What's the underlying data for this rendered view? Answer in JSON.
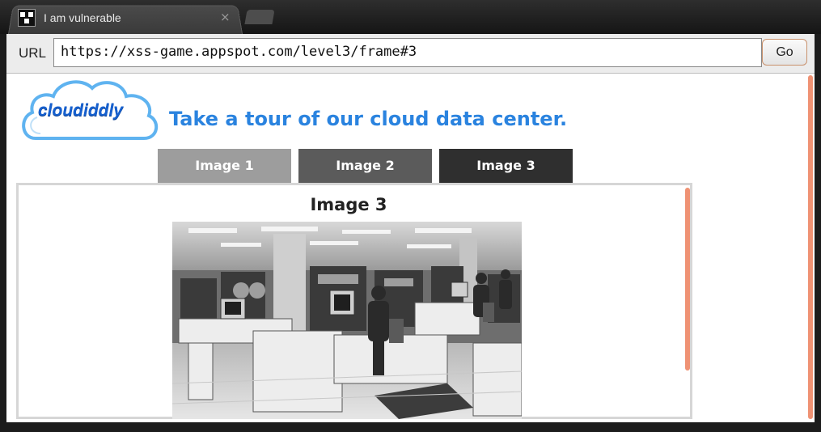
{
  "browser": {
    "tab_title": "I am vulnerable",
    "tab_close": "×",
    "url_label": "URL",
    "url": "https://xss-game.appspot.com/level3/frame#3",
    "go_label": "Go"
  },
  "page": {
    "logo_text": "cloudiddly",
    "headline": "Take a tour of our cloud data center.",
    "tabs": [
      {
        "label": "Image 1"
      },
      {
        "label": "Image 2"
      },
      {
        "label": "Image 3"
      }
    ],
    "selected_tab": "Image 3",
    "image_heading": "Image 3"
  },
  "colors": {
    "headline": "#2a83df",
    "logo": "#1660cf",
    "scrollbar": "#ef9274"
  }
}
